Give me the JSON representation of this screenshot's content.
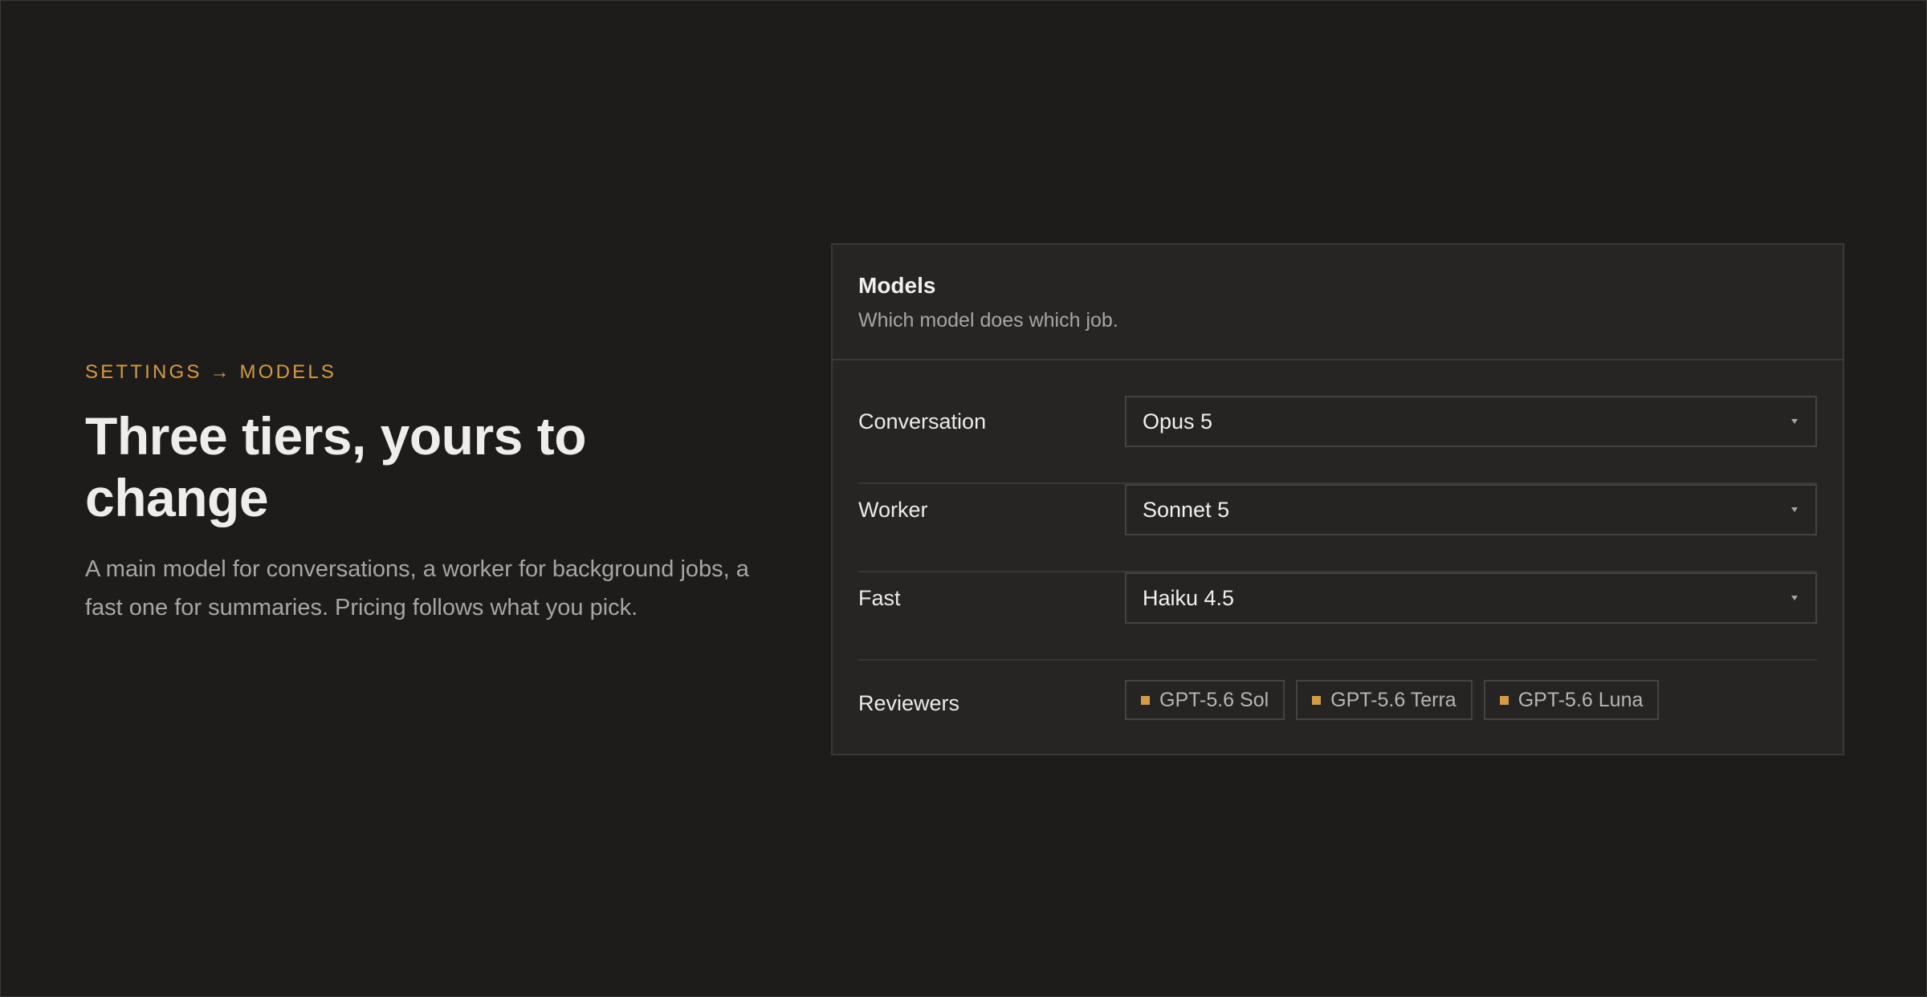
{
  "hero": {
    "eyebrow": "SETTINGS → MODELS",
    "headline": "Three tiers, yours to change",
    "lede": "A main model for conversations, a worker for background jobs, a fast one for summaries. Pricing follows what you pick."
  },
  "card": {
    "title": "Models",
    "subtitle": "Which model does which job.",
    "rows": [
      {
        "label": "Conversation",
        "value": "Opus 5"
      },
      {
        "label": "Worker",
        "value": "Sonnet 5"
      },
      {
        "label": "Fast",
        "value": "Haiku 4.5"
      }
    ],
    "reviewers": {
      "label": "Reviewers",
      "chips": [
        "GPT-5.6 Sol",
        "GPT-5.6 Terra",
        "GPT-5.6 Luna"
      ]
    }
  },
  "icons": {
    "select_caret": "chevron-down-icon",
    "chip_marker": "square-dot-icon"
  },
  "colors": {
    "background": "#1d1c1b",
    "card": "#262524",
    "accent": "#d49b45",
    "text_primary": "#efedea",
    "text_secondary": "#a8a6a2",
    "border": "#3a3937"
  }
}
